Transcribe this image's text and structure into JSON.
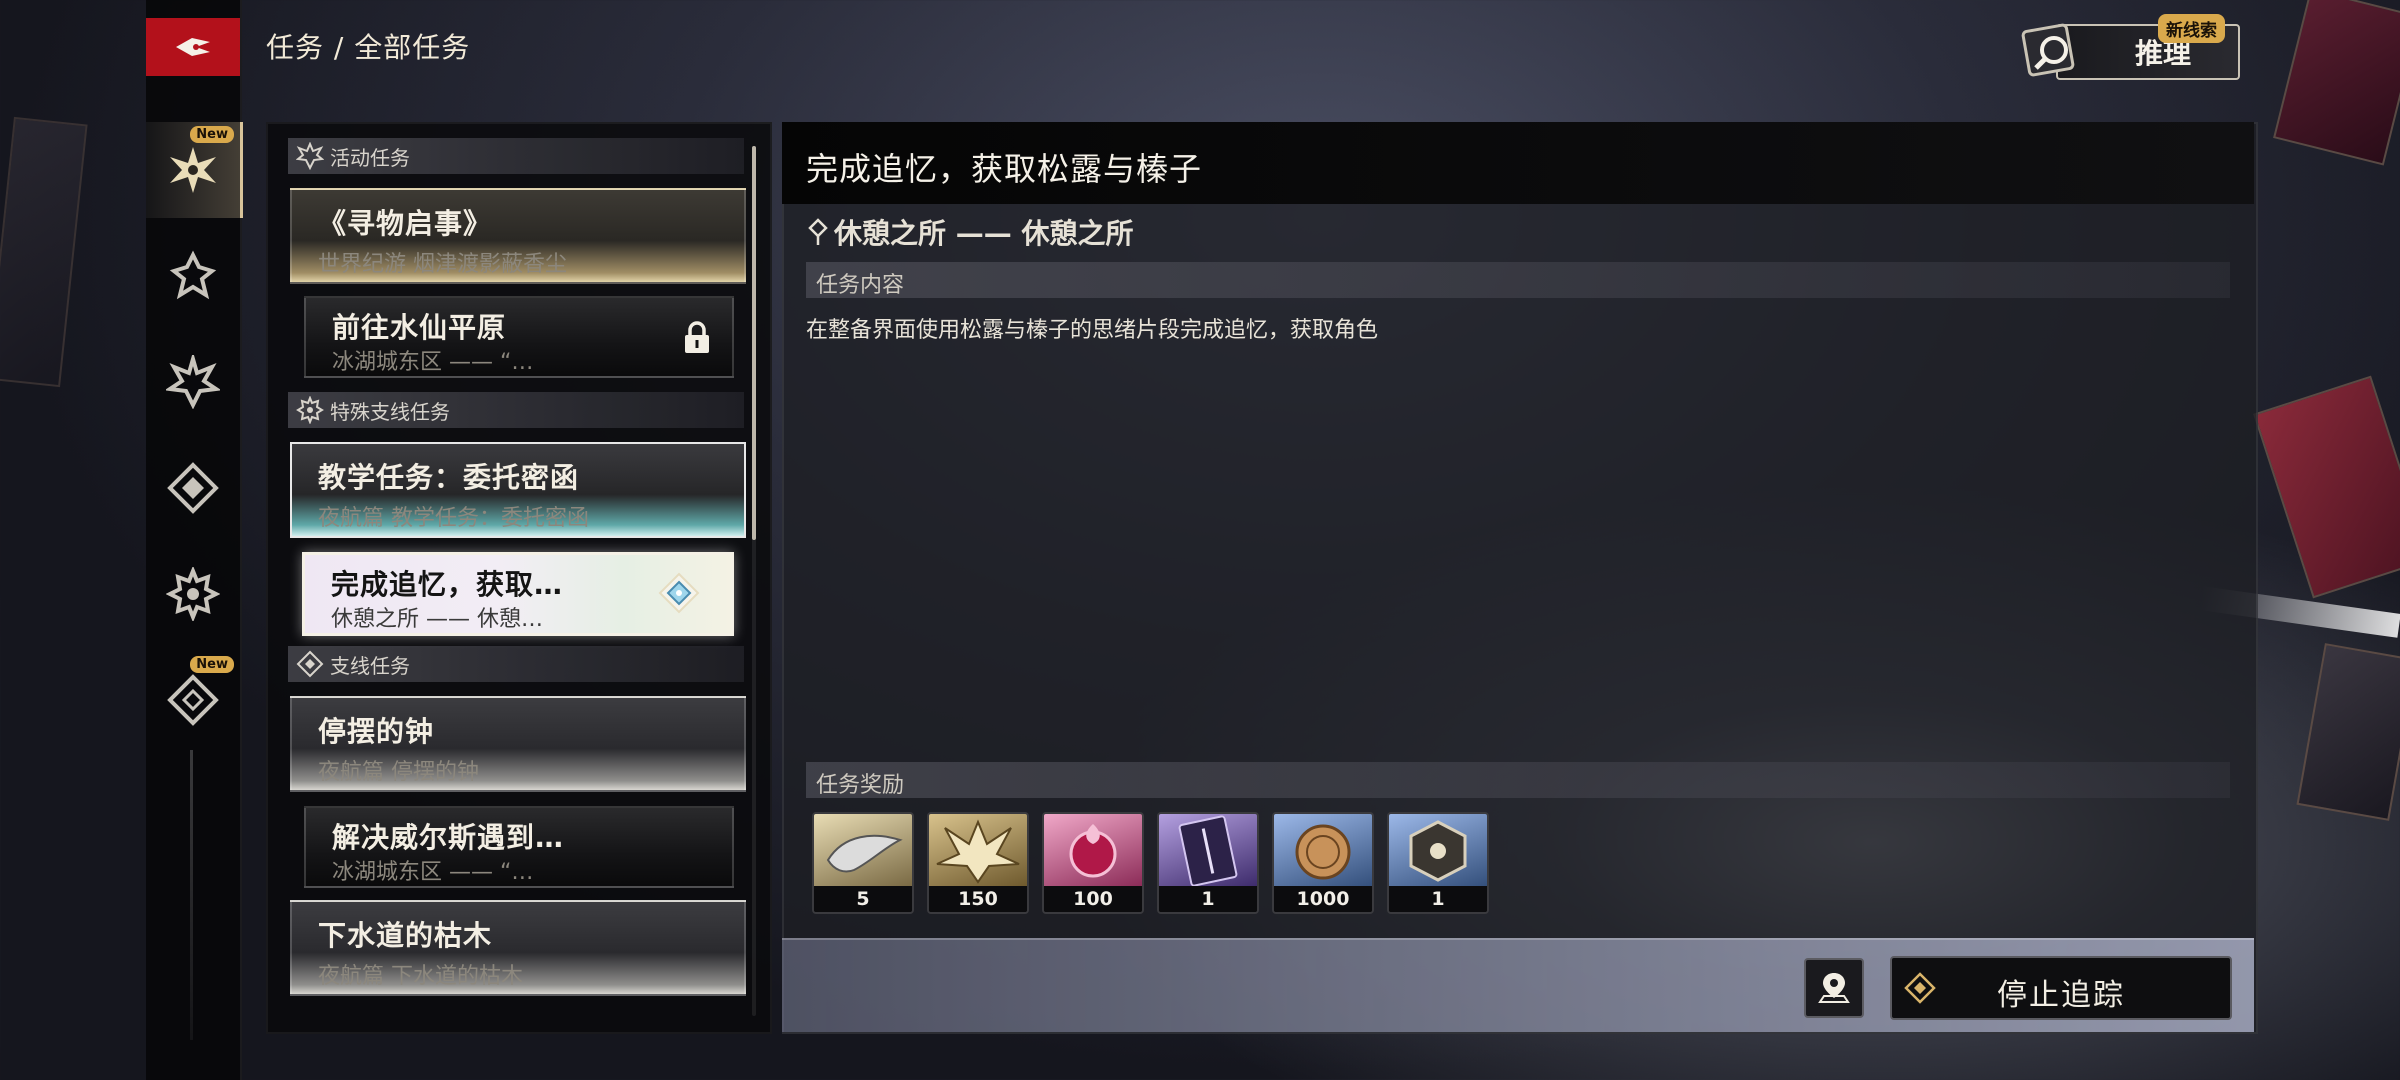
{
  "breadcrumb": "任务 / 全部任务",
  "deduce": {
    "label": "推理",
    "badge": "新线索"
  },
  "rail": {
    "badges": [
      "New",
      "New"
    ]
  },
  "categories": {
    "activity": "活动任务",
    "special": "特殊支线任务",
    "side": "支线任务"
  },
  "quests": [
    {
      "title": "《寻物启事》",
      "subtitle": "世界纪游 烟津渡影蔽香尘"
    },
    {
      "title": "前往水仙平原",
      "subtitle": "冰湖城东区 —— “…"
    },
    {
      "title": "教学任务：委托密函",
      "subtitle": "夜航篇 教学任务：委托密函"
    },
    {
      "title": "完成追忆，获取…",
      "subtitle": "休憩之所 —— 休憩…"
    },
    {
      "title": "停摆的钟",
      "subtitle": "夜航篇 停摆的钟"
    },
    {
      "title": "解决威尔斯遇到…",
      "subtitle": "冰湖城东区 —— “…"
    },
    {
      "title": "下水道的枯木",
      "subtitle": "夜航篇 下水道的枯木"
    }
  ],
  "detail": {
    "title": "完成追忆，获取松露与榛子",
    "location": "休憩之所 —— 休憩之所",
    "content_header": "任务内容",
    "content": "在整备界面使用松露与榛子的思绪片段完成追忆，获取角色",
    "rewards_header": "任务奖励",
    "rewards": [
      {
        "count": "5",
        "icon": "feather-scroll-icon"
      },
      {
        "count": "150",
        "icon": "horned-crest-icon"
      },
      {
        "count": "100",
        "icon": "crimson-orb-icon"
      },
      {
        "count": "1",
        "icon": "dagger-card-icon"
      },
      {
        "count": "1000",
        "icon": "bronze-coin-icon"
      },
      {
        "count": "1",
        "icon": "cube-eye-icon"
      }
    ],
    "stop_tracking": "停止追踪"
  },
  "colors": {
    "accent_red": "#b3111b",
    "badge_gold": "#d9a94c"
  }
}
